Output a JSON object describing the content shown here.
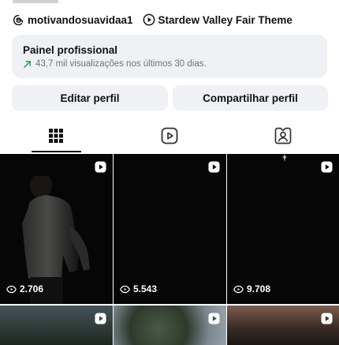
{
  "profile": {
    "threads_handle": "motivandosuavidaa1",
    "music_track": "Stardew Valley Fair Theme"
  },
  "professional_panel": {
    "title": "Painel profissional",
    "subtitle": "43,7 mil visualizações nos últimos 30 dias."
  },
  "actions": {
    "edit_label": "Editar perfil",
    "share_label": "Compartilhar perfil"
  },
  "tabs": [
    {
      "name": "grid",
      "icon": "grid-icon",
      "active": true
    },
    {
      "name": "reels",
      "icon": "reels-icon",
      "active": false
    },
    {
      "name": "tagged",
      "icon": "tagged-person-icon",
      "active": false
    }
  ],
  "posts": [
    {
      "type": "reel",
      "views": "2.706"
    },
    {
      "type": "reel",
      "views": "5.543"
    },
    {
      "type": "reel",
      "views": "9.708"
    },
    {
      "type": "reel",
      "views": ""
    },
    {
      "type": "reel",
      "views": ""
    },
    {
      "type": "reel",
      "views": ""
    }
  ],
  "colors": {
    "panel_bg": "#eff1f5",
    "trend_green": "#2e9e4f",
    "muted_text": "#737373"
  }
}
